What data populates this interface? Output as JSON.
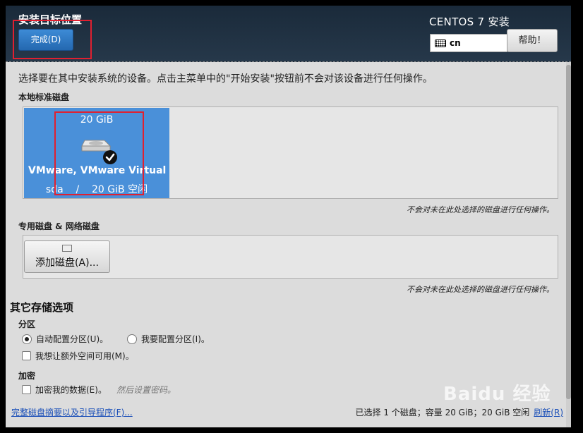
{
  "header": {
    "title": "安装目标位置",
    "done_label": "完成(D)",
    "product": "CENTOS 7 安装",
    "keyboard_layout": "cn",
    "help_label": "帮助！"
  },
  "description": "选择要在其中安装系统的设备。点击主菜单中的\"开始安装\"按钮前不会对该设备进行任何操作。",
  "local_disks": {
    "label": "本地标准磁盘",
    "disks": [
      {
        "size": "20 GiB",
        "name": "VMware, VMware Virtual S",
        "device": "sda",
        "free": "20 GiB 空闲",
        "selected": true
      }
    ],
    "note": "不会对未在此处选择的磁盘进行任何操作。"
  },
  "special_disks": {
    "label": "专用磁盘 & 网络磁盘",
    "add_label": "添加磁盘(A)...",
    "note": "不会对未在此处选择的磁盘进行任何操作。"
  },
  "other_options": {
    "title": "其它存储选项",
    "partitioning": {
      "label": "分区",
      "auto_label": "自动配置分区(U)。",
      "manual_label": "我要配置分区(I)。",
      "selected": "auto",
      "extra_space_label": "我想让额外空间可用(M)。",
      "extra_space_checked": false
    },
    "encryption": {
      "label": "加密",
      "encrypt_label": "加密我的数据(E)。",
      "encrypt_checked": false,
      "hint": "然后设置密码。"
    }
  },
  "footer": {
    "summary_link": "完整磁盘摘要以及引导程序(F)...",
    "status": "已选择 1 个磁盘；容量 20 GiB；20 GiB 空闲",
    "refresh_label": "刷新(R)"
  },
  "watermark": "Baidu 经验",
  "colors": {
    "header_bg": "#1a2a3a",
    "accent_blue": "#4a90d9",
    "highlight_red": "#e02030"
  }
}
